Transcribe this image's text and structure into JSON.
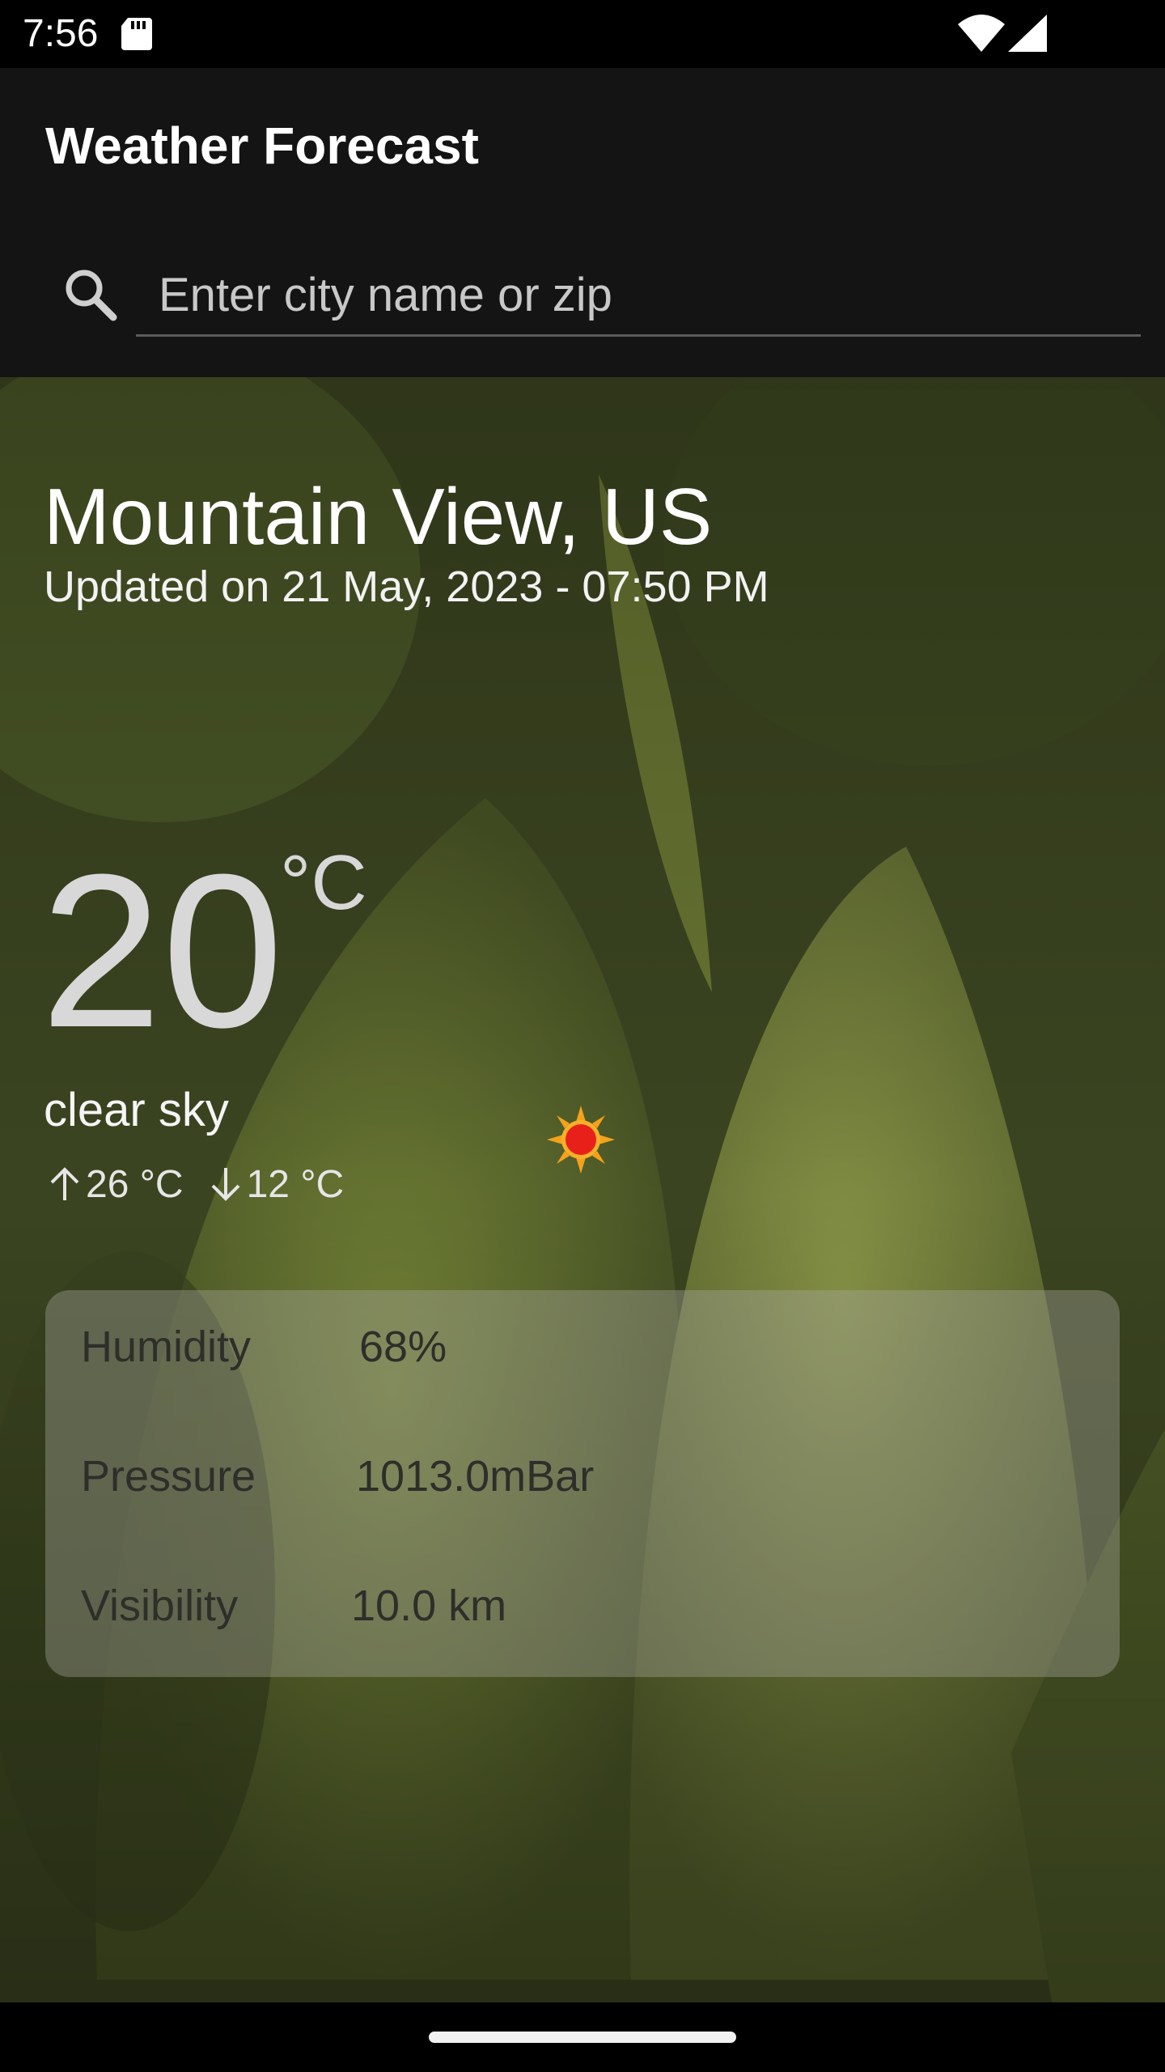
{
  "status_bar": {
    "time": "7:56"
  },
  "app_bar": {
    "title": "Weather Forecast"
  },
  "search": {
    "placeholder": "Enter city name or zip",
    "value": ""
  },
  "weather": {
    "city": "Mountain View, US",
    "updated": "Updated on 21 May, 2023 - 07:50 PM",
    "temperature": "20",
    "unit": "°C",
    "description": "clear sky",
    "temp_max": "26 °C",
    "temp_min": "12 °C",
    "icon": "sun-icon"
  },
  "details": [
    {
      "label": "Humidity",
      "value": "68%"
    },
    {
      "label": "Pressure",
      "value": "1013.0mBar"
    },
    {
      "label": "Visibility",
      "value": "10.0 km"
    }
  ],
  "colors": {
    "app_bar": "#141414",
    "background_tint": "#3f4a22",
    "sun_red": "#e8201a",
    "sun_orange": "#f4a21c"
  }
}
